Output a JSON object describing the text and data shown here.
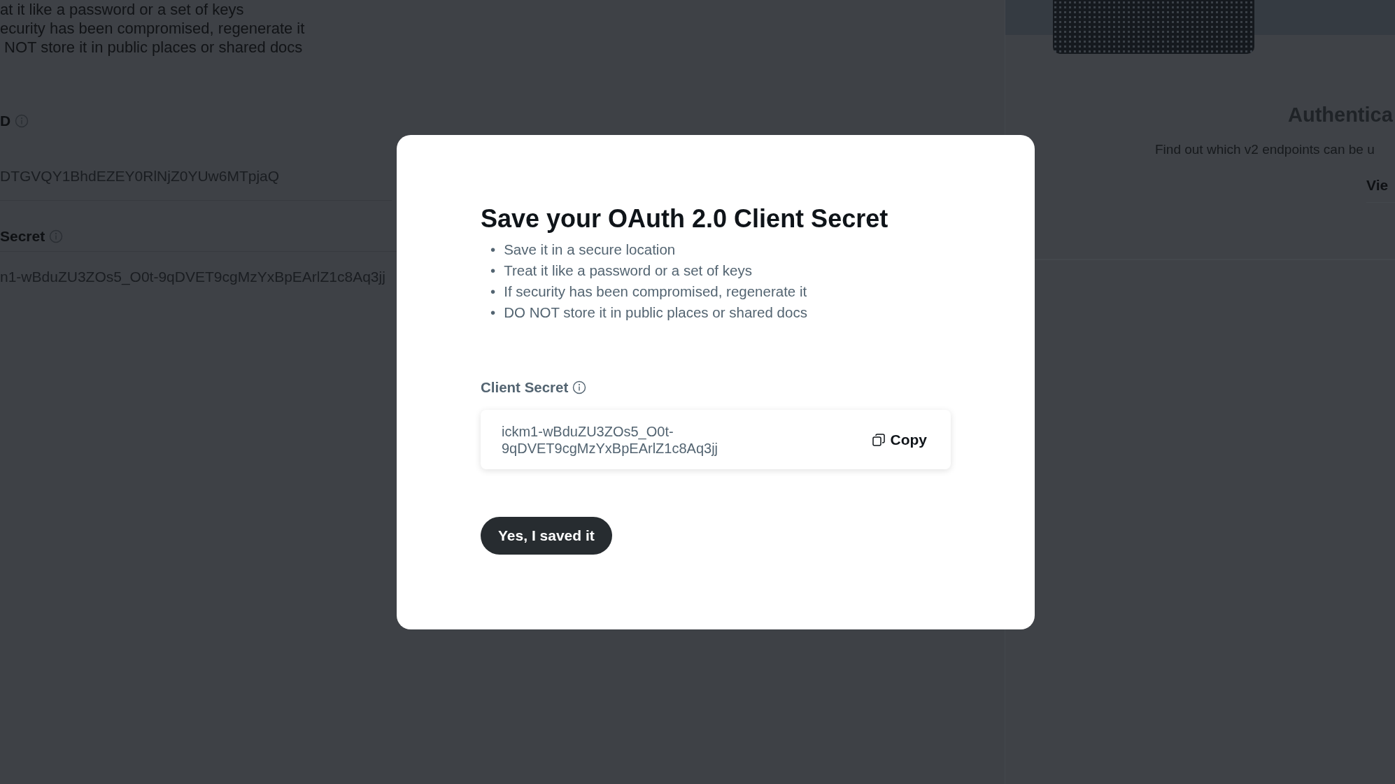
{
  "background_page": {
    "notes": [
      "at it like a password or a set of keys",
      "ecurity has been compromised, regenerate it",
      "NOT store it in public places or shared docs"
    ],
    "fields": [
      {
        "label": "D",
        "value": "DTGVQY1BhdEZEY0RlNjZ0YUw6MTpjaQ"
      },
      {
        "label": "Secret",
        "value": "n1-wBduZU3ZOs5_O0t-9qDVET9cgMzYxBpEArlZ1c8Aq3jj"
      }
    ],
    "side_card": {
      "title": "Authentica",
      "description": "Find out which v2 endpoints can be u",
      "link": "Vie"
    }
  },
  "modal": {
    "title": "Save your OAuth 2.0 Client Secret",
    "bullets": [
      {
        "marker": "•",
        "text": "Save it in a secure location"
      },
      {
        "marker": "•",
        "text": "Treat it like a password or a set of keys"
      },
      {
        "marker": "•",
        "text": "If security has been compromised, regenerate it"
      },
      {
        "marker": "•",
        "text": "DO NOT store it in public places or shared docs"
      }
    ],
    "field": {
      "label": "Client Secret",
      "value": "ickm1-wBduZU3ZOs5_O0t-9qDVET9cgMzYxBpEArlZ1c8Aq3jj",
      "copy_button": "Copy"
    },
    "confirm_button": "Yes, I saved it"
  }
}
